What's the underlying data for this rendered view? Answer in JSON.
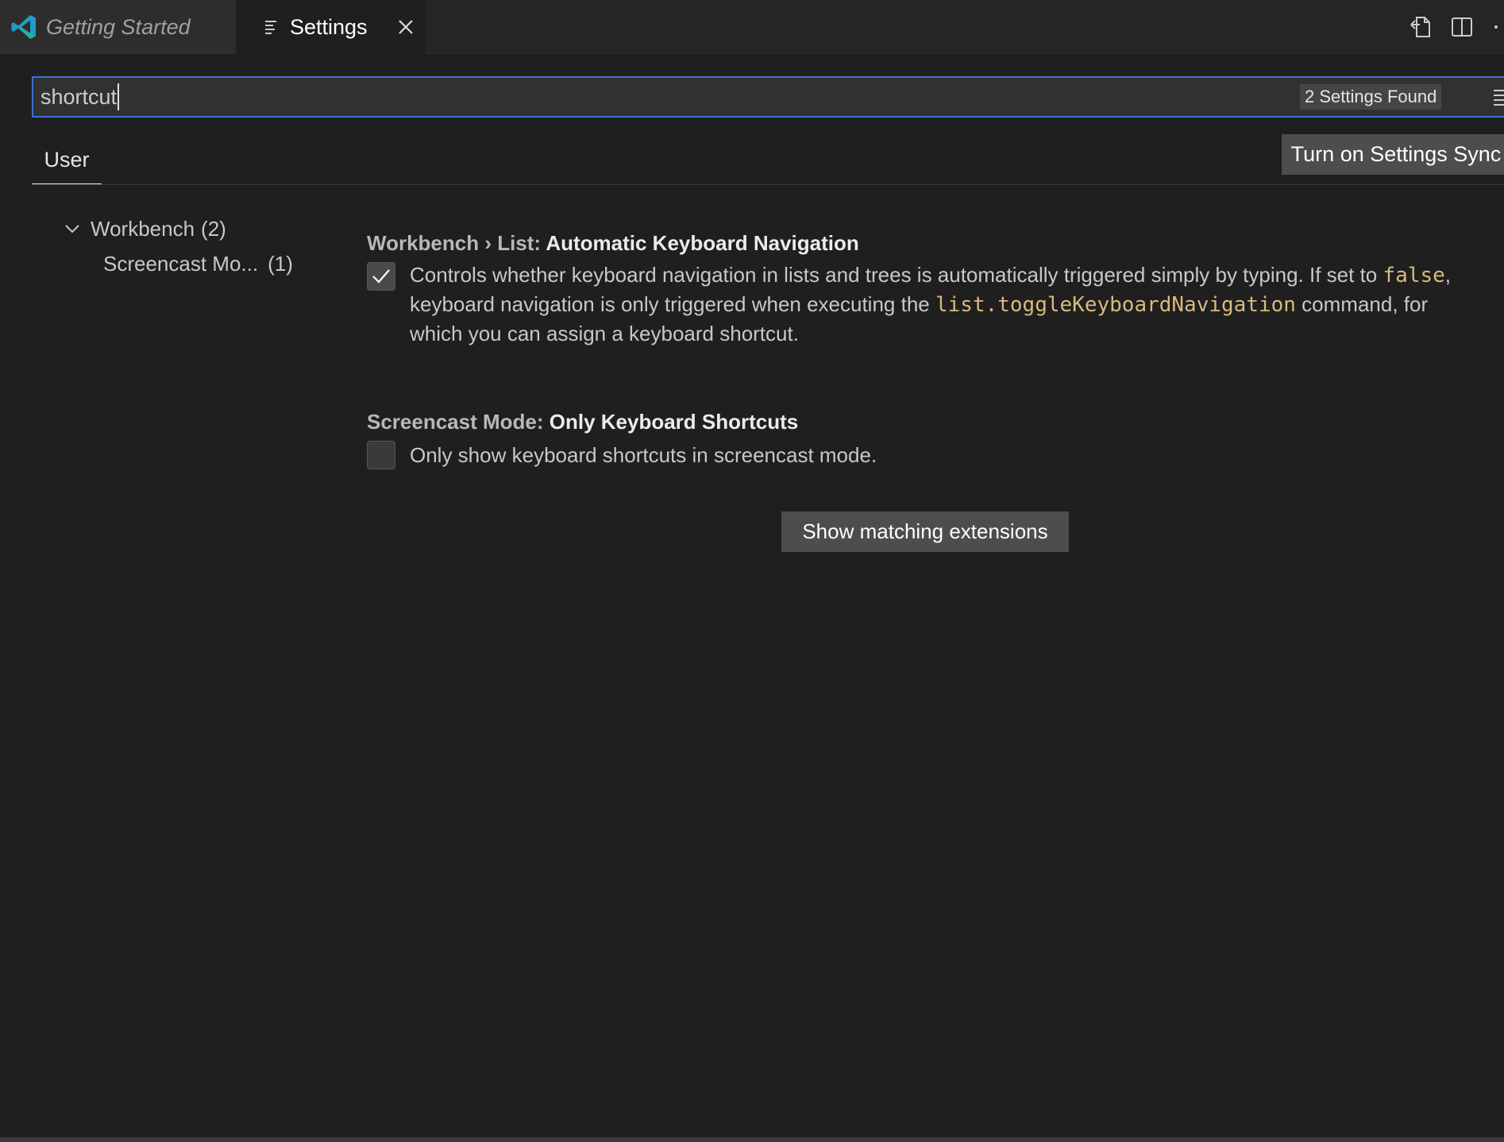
{
  "tabs": [
    {
      "label": "Getting Started",
      "active": false
    },
    {
      "label": "Settings",
      "active": true
    }
  ],
  "search": {
    "value": "shortcut",
    "results_badge": "2 Settings Found"
  },
  "scope_tabs": [
    {
      "label": "User"
    }
  ],
  "sync_button_label": "Turn on Settings Sync",
  "toc": {
    "group": {
      "label": "Workbench",
      "count": "(2)"
    },
    "item": {
      "label": "Screencast Mo...",
      "count": "(1)"
    }
  },
  "settings": [
    {
      "category": "Workbench › List: ",
      "name": "Automatic Keyboard Navigation",
      "checked": true,
      "desc_part1": "Controls whether keyboard navigation in lists and trees is automatically triggered simply by typing. If set to ",
      "code1": "false",
      "desc_part2": ", keyboard navigation is only triggered when executing the ",
      "code2": "list.toggleKeyboardNavigation",
      "desc_part3": " command, for which you can assign a keyboard shortcut."
    },
    {
      "category": "Screencast Mode: ",
      "name": "Only Keyboard Shortcuts",
      "checked": false,
      "description": "Only show keyboard shortcuts in screencast mode."
    }
  ],
  "extensions_button_label": "Show matching extensions",
  "colors": {
    "background": "#1f1f1f",
    "focus_border": "#3c6fd1",
    "code": "#d7ba7d",
    "logo": "#23a8b5"
  }
}
